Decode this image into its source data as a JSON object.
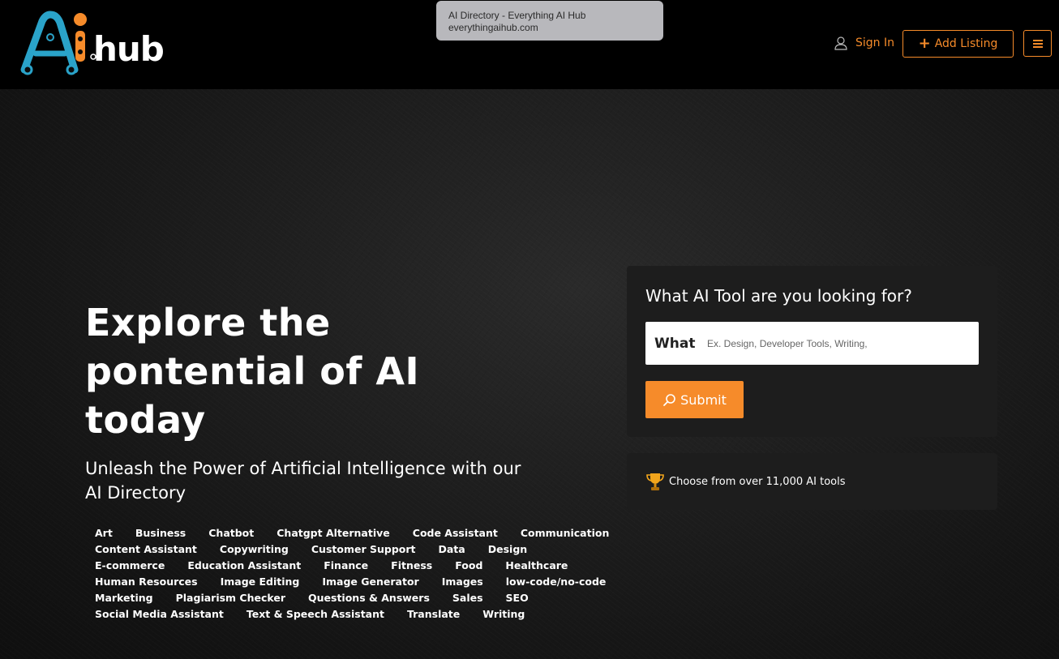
{
  "tooltip": {
    "title": "AI Directory - Everything AI Hub",
    "url": "everythingaihub.com"
  },
  "header": {
    "logo_text": "AIhub",
    "signin_label": "Sign In",
    "add_listing_label": "Add Listing"
  },
  "hero": {
    "headline_lines": [
      "Explore the",
      "pontential of AI",
      "today"
    ],
    "subheadline_lines": [
      "Unleash the Power of Artificial Intelligence with our",
      "AI Directory"
    ],
    "tag_rows": [
      [
        "Art",
        "Business",
        "Chatbot",
        "Chatgpt Alternative",
        "Code Assistant",
        "Communication"
      ],
      [
        "Content Assistant",
        "Copywriting",
        "Customer Support",
        "Data",
        "Design"
      ],
      [
        "E-commerce",
        "Education Assistant",
        "Finance",
        "Fitness",
        "Food",
        "Healthcare"
      ],
      [
        "Human Resources",
        "Image Editing",
        "Image Generator",
        "Images",
        "low-code/no-code"
      ],
      [
        "Marketing",
        "Plagiarism Checker",
        "Questions & Answers",
        "Sales",
        "SEO"
      ],
      [
        "Social Media Assistant",
        "Text & Speech Assistant",
        "Translate",
        "Writing"
      ]
    ]
  },
  "search": {
    "question": "What AI Tool are you looking for?",
    "what_label": "What",
    "placeholder": "Ex. Design, Developer Tools, Writing,",
    "value": "",
    "submit_label": "Submit"
  },
  "tools_info": {
    "text": "Choose from over 11,000 AI tools"
  },
  "colors": {
    "accent": "#f68b2a",
    "logo_blue": "#2aa3c9",
    "panel": "#1d1d1d"
  },
  "icons": {
    "signin": "user-icon",
    "add_listing": "plus-icon",
    "menu": "hamburger-icon",
    "submit": "search-icon",
    "tools": "trophy-icon"
  }
}
